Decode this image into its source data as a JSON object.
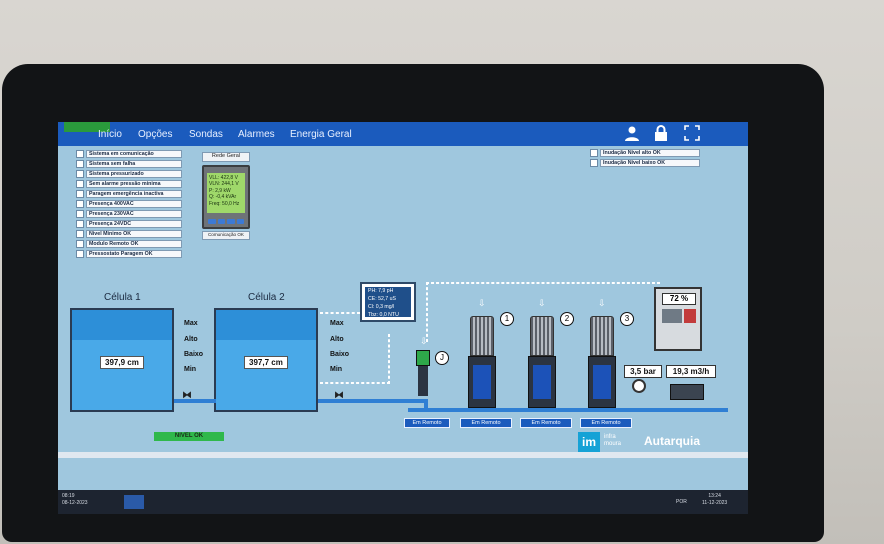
{
  "menu": {
    "items": [
      "Início",
      "Opções",
      "Sondas",
      "Alarmes",
      "Energia Geral"
    ]
  },
  "status_list": [
    "Sistema em comunicação",
    "Sistema sem falha",
    "Sistema pressurizado",
    "Sem alarme pressão minima",
    "Paragem emergência inactiva",
    "Presença 400VAC",
    "Presença 230VAC",
    "Presença 24VDC",
    "Nivel Minimo OK",
    "Modulo Remoto OK",
    "Pressostato Paragem OK"
  ],
  "rede_geral": {
    "title": "Rede Geral",
    "lines": [
      "VLL: 422,8 V",
      "VLN: 244,1 V",
      "P: 2,9 kW",
      "Q: -0,4 kVAr",
      "Freq: 50,0 Hz"
    ],
    "comm": "Comunicação OK"
  },
  "inundacao": [
    "Inudação Nível alto OK",
    "Inudação Nível baixo OK"
  ],
  "cells": [
    {
      "title": "Célula 1",
      "value": "397,9 cm",
      "fill": 0.7
    },
    {
      "title": "Célula 2",
      "value": "397,7 cm",
      "fill": 0.7
    }
  ],
  "levels": [
    "Max",
    "Alto",
    "Baixo",
    "Min"
  ],
  "nivel_ok": "NIVEL OK",
  "quality": [
    "PH: 7,9 pH",
    "CE: 52,7 uS",
    "Cl: 0,3 mg/l",
    "Tbz: 0,0 NTU"
  ],
  "filter_label": "J",
  "pumps": [
    {
      "number": "1",
      "mode": "Em Remoto"
    },
    {
      "number": "2",
      "mode": "Em Remoto"
    },
    {
      "number": "3",
      "mode": "Em Remoto"
    }
  ],
  "filter_mode": "Em Remoto",
  "panel_percent": "72 %",
  "pressure": "3,5 bar",
  "flow": "19,3 m3/h",
  "brand": {
    "im": "im",
    "line1": "infra",
    "line2": "moura",
    "autarquia": "Autarquia"
  },
  "taskbar": {
    "left_time": "08:19",
    "left_date": "08-12-2023",
    "lang": "POR",
    "time": "13:24",
    "date": "11-12-2023"
  }
}
